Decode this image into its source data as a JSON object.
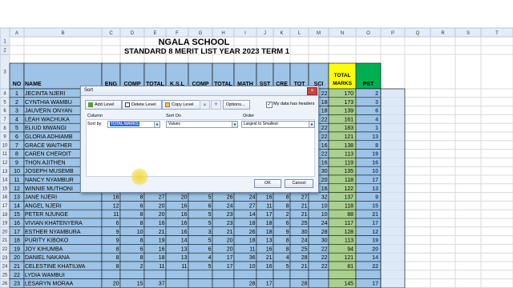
{
  "sheet": {
    "top_cols": [
      "A",
      "B",
      "C",
      "D",
      "E",
      "F",
      "G",
      "H",
      "I",
      "J",
      "K",
      "L",
      "M",
      "N",
      "O",
      "P",
      "Q",
      "R",
      "S",
      "T"
    ],
    "school": "NGALA SCHOOL",
    "subtitle": "STANDARD 8 MERIT LIST YEAR 2023 TERM 1",
    "row_numbers": [
      "1",
      "2",
      "3",
      "4",
      "5",
      "6",
      "7",
      "8",
      "9",
      "10",
      "11",
      "12",
      "13",
      "14",
      "15",
      "16",
      "17",
      "18",
      "19",
      "20",
      "21",
      "22",
      "23",
      "24",
      "25",
      "26"
    ],
    "table_headers": [
      "NO",
      "NAME",
      "ENG",
      "COMP",
      "TOTAL",
      "K.S.L",
      "COMP",
      "TOTAL",
      "MATH",
      "SST",
      "CRE",
      "TOT",
      "SCI",
      "TOTAL MARKS",
      "PST"
    ],
    "rows": [
      {
        "no": "1",
        "name": "JECINTA NJERI",
        "vals": [
          "",
          "",
          "",
          "",
          "",
          "",
          "",
          "",
          "",
          "",
          "22"
        ],
        "tm": "170",
        "pst": "2"
      },
      {
        "no": "2",
        "name": "CYNTHIA WAMBU",
        "vals": [
          "",
          "",
          "",
          "",
          "",
          "",
          "",
          "",
          "",
          "",
          "18"
        ],
        "tm": "173",
        "pst": "3"
      },
      {
        "no": "3",
        "name": "JAUVERN ONYAN",
        "vals": [
          "",
          "",
          "",
          "",
          "",
          "",
          "",
          "",
          "",
          "",
          "18"
        ],
        "tm": "139",
        "pst": "6"
      },
      {
        "no": "4",
        "name": "LEAH WACHUKA",
        "vals": [
          "",
          "",
          "",
          "",
          "",
          "",
          "",
          "",
          "",
          "",
          "22"
        ],
        "tm": "161",
        "pst": "4"
      },
      {
        "no": "5",
        "name": "ELIUD MWANGI",
        "vals": [
          "",
          "",
          "",
          "",
          "",
          "",
          "",
          "",
          "",
          "",
          "22"
        ],
        "tm": "183",
        "pst": "1"
      },
      {
        "no": "6",
        "name": "GLORIA ADHIAMB",
        "vals": [
          "",
          "",
          "",
          "",
          "",
          "",
          "",
          "",
          "",
          "",
          "22"
        ],
        "tm": "121",
        "pst": "13"
      },
      {
        "no": "7",
        "name": "GRACE WAITHER",
        "vals": [
          "",
          "",
          "",
          "",
          "",
          "",
          "",
          "",
          "",
          "",
          "16"
        ],
        "tm": "138",
        "pst": "8"
      },
      {
        "no": "8",
        "name": "CAREN CHEROIT",
        "vals": [
          "",
          "",
          "",
          "",
          "",
          "",
          "",
          "",
          "",
          "",
          "22"
        ],
        "tm": "113",
        "pst": "19"
      },
      {
        "no": "9",
        "name": "THON AJITHEN",
        "vals": [
          "",
          "",
          "",
          "",
          "",
          "",
          "",
          "",
          "",
          "",
          "16"
        ],
        "tm": "119",
        "pst": "16"
      },
      {
        "no": "10",
        "name": "JOSEPH MUSEMB",
        "vals": [
          "",
          "",
          "",
          "",
          "",
          "",
          "",
          "",
          "",
          "",
          "30"
        ],
        "tm": "135",
        "pst": "10"
      },
      {
        "no": "11",
        "name": "NANCY NYAMBUR",
        "vals": [
          "",
          "",
          "",
          "",
          "",
          "",
          "",
          "",
          "",
          "",
          "20"
        ],
        "tm": "118",
        "pst": "17"
      },
      {
        "no": "12",
        "name": "WINNIE MUTHONI",
        "vals": [
          "",
          "",
          "",
          "",
          "",
          "",
          "",
          "",
          "",
          "",
          "16"
        ],
        "tm": "122",
        "pst": "13"
      },
      {
        "no": "13",
        "name": "JANE NJERI",
        "vals": [
          "16",
          "8",
          "27",
          "20",
          "5",
          "26",
          "24",
          "16",
          "8",
          "27",
          "32"
        ],
        "tm": "137",
        "pst": "9"
      },
      {
        "no": "14",
        "name": "ANGEL NJERI",
        "vals": [
          "12",
          "6",
          "20",
          "16",
          "6",
          "24",
          "27",
          "11",
          "8",
          "21",
          "10"
        ],
        "tm": "118",
        "pst": "15"
      },
      {
        "no": "15",
        "name": "PETER NJUNGE",
        "vals": [
          "11",
          "8",
          "20",
          "16",
          "5",
          "23",
          "14",
          "17",
          "2",
          "21",
          "10"
        ],
        "tm": "88",
        "pst": "21"
      },
      {
        "no": "16",
        "name": "VIVIAN KHATENYERA",
        "vals": [
          "6",
          "8",
          "16",
          "16",
          "5",
          "23",
          "18",
          "18",
          "6",
          "25",
          "24"
        ],
        "tm": "117",
        "pst": "17"
      },
      {
        "no": "17",
        "name": "ESTHER NYAMBURA",
        "vals": [
          "9",
          "10",
          "21",
          "16",
          "3",
          "21",
          "26",
          "18",
          "9",
          "30",
          "28"
        ],
        "tm": "128",
        "pst": "12"
      },
      {
        "no": "18",
        "name": "PURITY KIBOKO",
        "vals": [
          "9",
          "8",
          "19",
          "14",
          "5",
          "20",
          "18",
          "13",
          "8",
          "24",
          "30"
        ],
        "tm": "113",
        "pst": "19"
      },
      {
        "no": "19",
        "name": "JOY KIHUMBA",
        "vals": [
          "8",
          "6",
          "16",
          "13",
          "6",
          "20",
          "11",
          "16",
          "8",
          "25",
          "22"
        ],
        "tm": "94",
        "pst": "20"
      },
      {
        "no": "20",
        "name": "DANIEL NAKANA",
        "vals": [
          "8",
          "8",
          "18",
          "13",
          "4",
          "17",
          "36",
          "21",
          "4",
          "28",
          "22"
        ],
        "tm": "121",
        "pst": "14"
      },
      {
        "no": "21",
        "name": "CELESTINE KHATILWA",
        "vals": [
          "8",
          "2",
          "11",
          "11",
          "5",
          "17",
          "10",
          "16",
          "5",
          "21",
          "22"
        ],
        "tm": "81",
        "pst": "22"
      },
      {
        "no": "22",
        "name": "LYDIA WAMBUI",
        "vals": [
          "",
          "",
          "",
          "",
          "",
          "",
          "",
          "",
          "",
          "",
          ""
        ],
        "tm": "",
        "pst": ""
      },
      {
        "no": "23",
        "name": "LESARYN MORAA",
        "vals": [
          "20",
          "15",
          "37",
          "",
          "",
          "",
          "28",
          "17",
          "",
          "28",
          ""
        ],
        "tm": "145",
        "pst": "17"
      }
    ]
  },
  "dialog": {
    "title": "Sort",
    "close": "×",
    "add_level": "Add Level",
    "delete_level": "Delete Level",
    "copy_level": "Copy Level",
    "move_up": "▲",
    "move_down": "▼",
    "options": "Options...",
    "headers_check": "✓",
    "headers_label": "My data has headers",
    "col_column": "Column",
    "col_sort_on": "Sort On",
    "col_order": "Order",
    "sort_by": "Sort by",
    "column_value": "TOTAL MARKS",
    "sort_on_value": "Values",
    "order_value": "Largest to Smallest",
    "ok": "OK",
    "cancel": "Cancel"
  },
  "colors": {
    "blue_cells": "#9dc3e6",
    "total_marks": "#ffff00",
    "pst": "#00b050",
    "tm_rows": "#a9d08e"
  }
}
